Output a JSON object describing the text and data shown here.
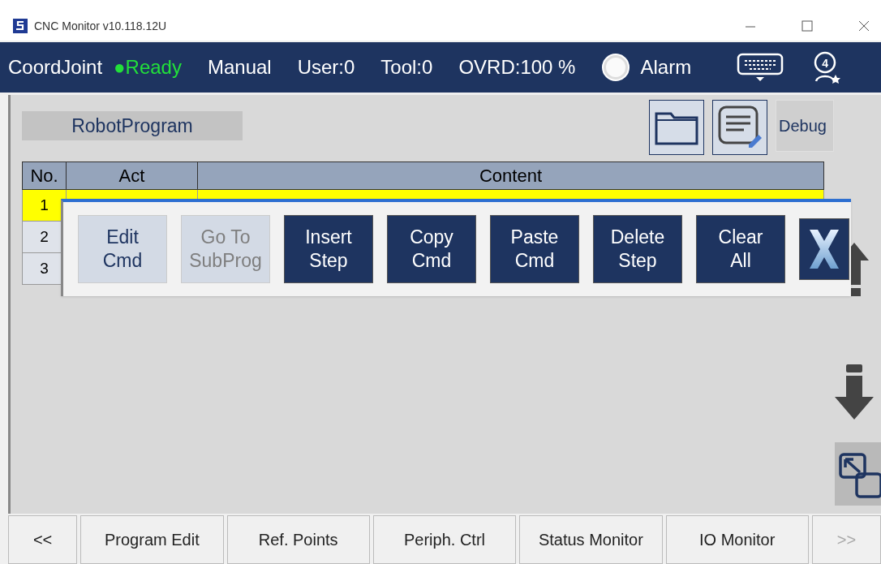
{
  "window": {
    "title": "CNC Monitor v10.118.12U"
  },
  "status_bar": {
    "items": [
      {
        "text": "CoordJoint",
        "kind": "plain"
      },
      {
        "text": "●Ready",
        "kind": "ok"
      },
      {
        "text": "Manual",
        "kind": "plain"
      },
      {
        "text": "User:0",
        "kind": "plain"
      },
      {
        "text": "Tool:0",
        "kind": "plain"
      },
      {
        "text": "OVRD:100 %",
        "kind": "plain"
      },
      {
        "text": "Alarm",
        "kind": "alarm"
      }
    ],
    "user_badge": "4"
  },
  "program": {
    "title": "RobotProgram",
    "debug_button": "Debug"
  },
  "table": {
    "columns": [
      "No.",
      "Act",
      "Content"
    ],
    "rows": [
      {
        "no": "1",
        "selected": true
      },
      {
        "no": "2",
        "selected": false
      },
      {
        "no": "3",
        "selected": false
      }
    ]
  },
  "popup": {
    "buttons": [
      {
        "lines": [
          "Edit",
          "Cmd"
        ],
        "kind": "light",
        "disabled": false
      },
      {
        "lines": [
          "Go To",
          "SubProg"
        ],
        "kind": "light",
        "disabled": true
      },
      {
        "lines": [
          "Insert",
          "Step"
        ],
        "kind": "dark",
        "disabled": false
      },
      {
        "lines": [
          "Copy",
          "Cmd"
        ],
        "kind": "dark",
        "disabled": false
      },
      {
        "lines": [
          "Paste",
          "Cmd"
        ],
        "kind": "dark",
        "disabled": false
      },
      {
        "lines": [
          "Delete",
          "Step"
        ],
        "kind": "dark",
        "disabled": false
      },
      {
        "lines": [
          "Clear",
          "All"
        ],
        "kind": "dark",
        "disabled": false
      }
    ]
  },
  "bottom_tabs": [
    {
      "label": "<<",
      "disabled": false
    },
    {
      "label": "Program Edit",
      "disabled": false
    },
    {
      "label": "Ref. Points",
      "disabled": false
    },
    {
      "label": "Periph. Ctrl",
      "disabled": false
    },
    {
      "label": "Status Monitor",
      "disabled": false
    },
    {
      "label": "IO Monitor",
      "disabled": false
    },
    {
      "label": ">>",
      "disabled": true
    }
  ]
}
